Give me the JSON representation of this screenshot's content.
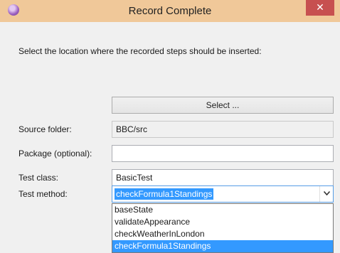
{
  "window": {
    "title": "Record Complete",
    "close_glyph": "✕"
  },
  "icons": {
    "app": "app-icon",
    "close": "close-icon",
    "dropdown": "chevron-down-icon"
  },
  "instruction": "Select the location where the recorded steps should be inserted:",
  "select_button": "Select ...",
  "form": {
    "source_folder": {
      "label": "Source folder:",
      "value": "BBC/src"
    },
    "package": {
      "label": "Package (optional):",
      "value": ""
    },
    "test_class": {
      "label": "Test class:",
      "value": "BasicTest"
    },
    "test_method": {
      "label": "Test method:",
      "value": "checkFormula1Standings",
      "options": [
        "baseState",
        "validateAppearance",
        "checkWeatherInLondon",
        "checkFormula1Standings"
      ],
      "highlighted_option": "checkFormula1Standings"
    }
  },
  "colors": {
    "titlebar": "#f0c899",
    "close_button": "#c75050",
    "selection": "#3399ff"
  }
}
